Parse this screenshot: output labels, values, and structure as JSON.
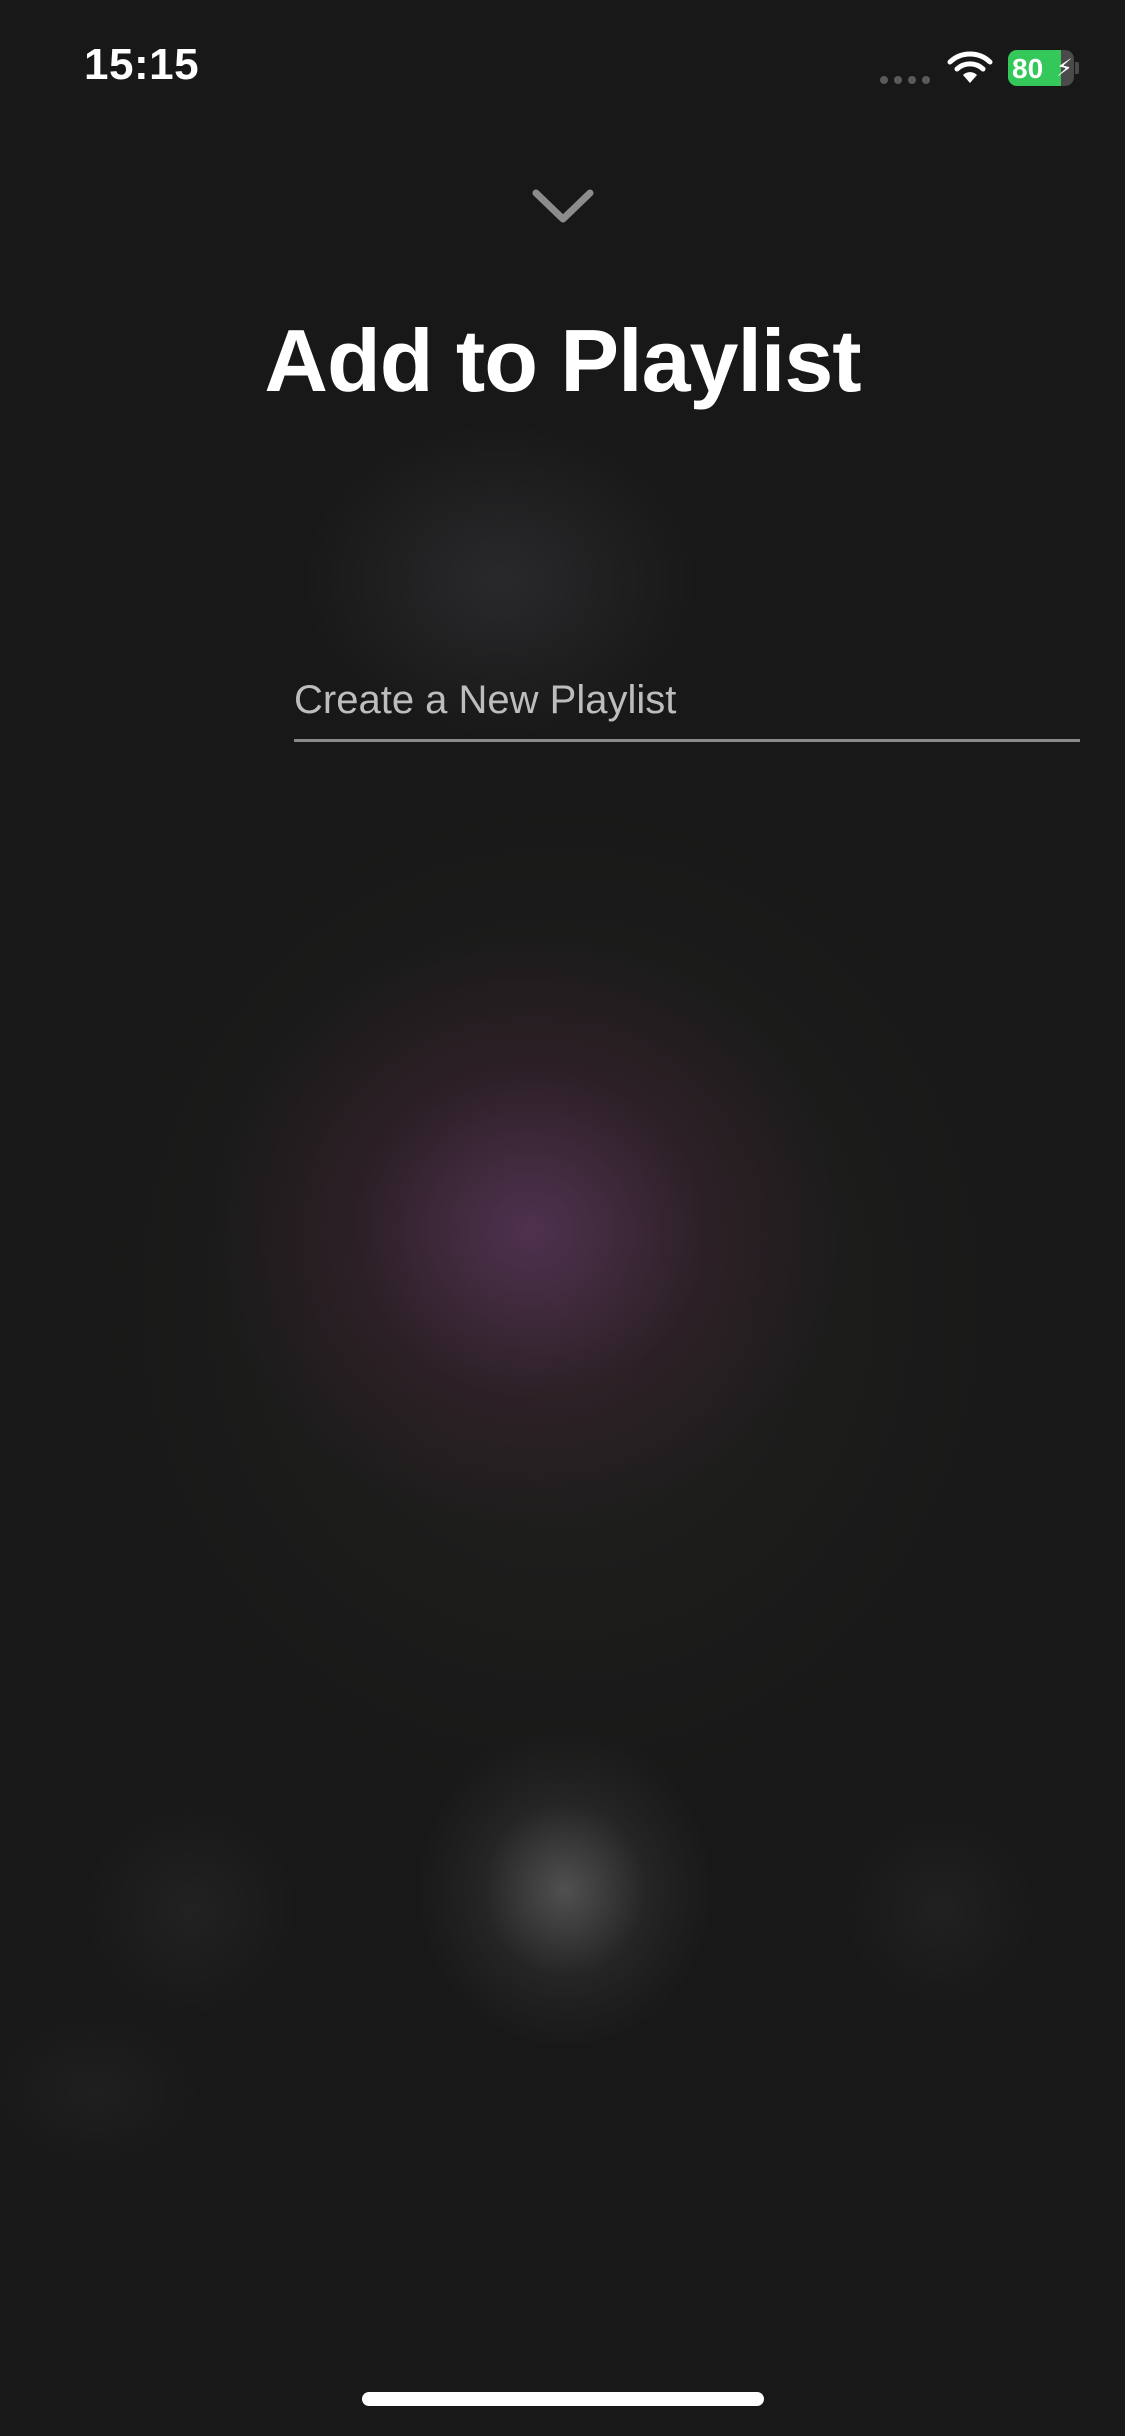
{
  "status_bar": {
    "time": "15:15",
    "battery_level": "80",
    "battery_percent": 80,
    "battery_color": "#34c759",
    "charging": true
  },
  "header": {
    "dismiss_icon": "chevron-down-icon",
    "title": "Add to Playlist"
  },
  "new_playlist": {
    "placeholder": "Create a New Playlist",
    "value": ""
  }
}
